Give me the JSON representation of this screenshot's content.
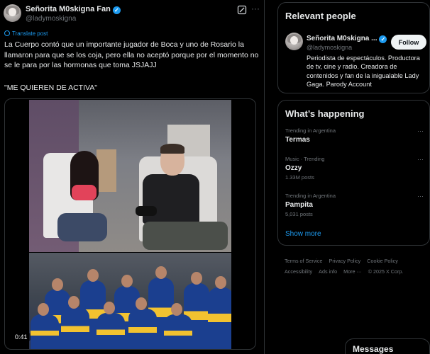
{
  "post": {
    "display_name": "Señorita M0skigna Fan",
    "handle": "@ladymoskigna",
    "translate_label": "Translate post",
    "text": "La Cuerpo contó que un importante jugador de Boca y uno de Rosario la llamaron para que se los coja, pero ella no aceptó porque por el momento no se le para por las hormonas que toma JSJAJJ",
    "quote_line": "\"ME QUIEREN DE ACTIVA\"",
    "video_time": "0:41"
  },
  "relevant": {
    "title": "Relevant people",
    "name": "Señorita M0skigna ...",
    "handle": "@ladymoskigna",
    "follow_label": "Follow",
    "bio": "Periodista de espectáculos. Productora de tv, cine y radio. Creadora de contenidos y fan de la inigualable Lady Gaga. Parody Account"
  },
  "happening": {
    "title": "What’s happening",
    "trends": [
      {
        "meta": "Trending in Argentina",
        "name": "Termas",
        "posts": ""
      },
      {
        "meta": "Music · Trending",
        "name": "Ozzy",
        "posts": "1.33M posts"
      },
      {
        "meta": "Trending in Argentina",
        "name": "Pampita",
        "posts": "5,031 posts"
      }
    ],
    "show_more": "Show more"
  },
  "footer": {
    "links": [
      "Terms of Service",
      "Privacy Policy",
      "Cookie Policy",
      "Accessibility",
      "Ads info",
      "More ···",
      "© 2025 X Corp."
    ]
  },
  "messages": {
    "label": "Messages"
  },
  "colors": {
    "accent": "#1d9bf0",
    "background": "#000000",
    "text": "#e7e9ea",
    "muted": "#71767b",
    "border": "#2f3336"
  },
  "icons": [
    "verified-badge-icon",
    "grok-icon",
    "more-icon",
    "globe-icon"
  ]
}
